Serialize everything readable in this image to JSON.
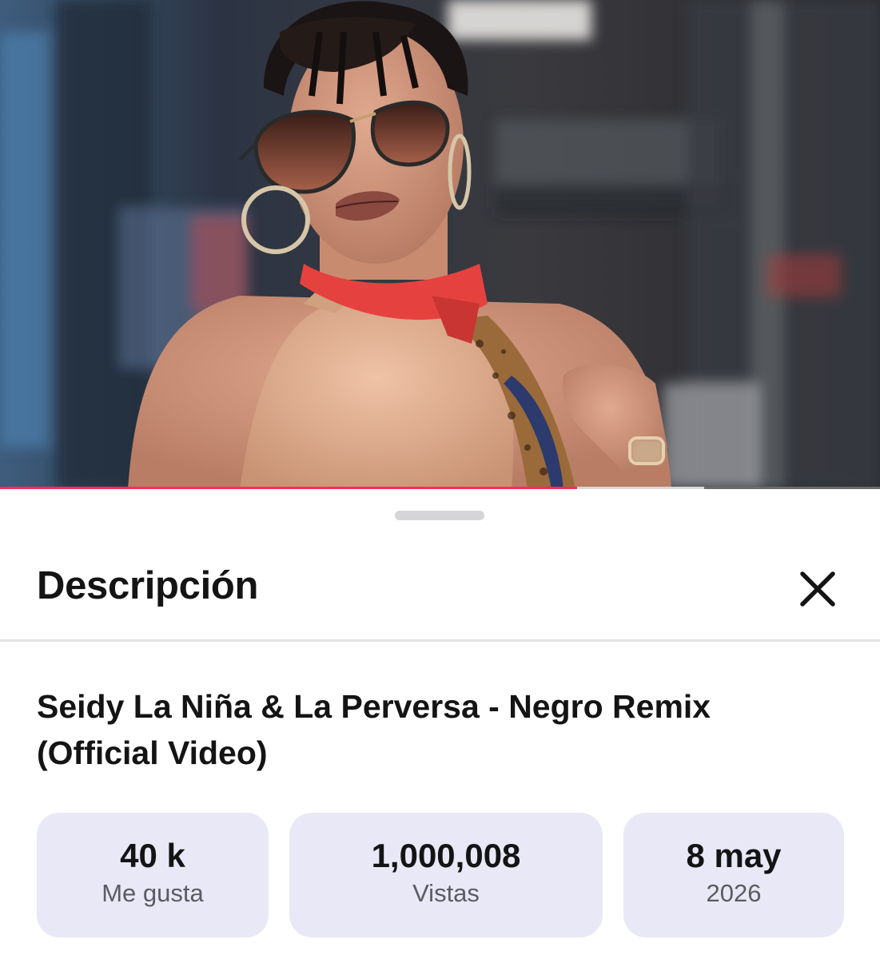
{
  "player": {
    "played_fraction": 0.656,
    "buffered_fraction": 0.8,
    "accent_color": "#ff2d55"
  },
  "sheet": {
    "title": "Descripción",
    "close_icon": "close-icon",
    "video_title": "Seidy La Niña & La Perversa - Negro Remix (Official Video)",
    "stats": [
      {
        "value": "40 k",
        "label": "Me gusta"
      },
      {
        "value": "1,000,008",
        "label": "Vistas"
      },
      {
        "value": "8 may",
        "label": "2026"
      }
    ],
    "card_color": "#e9e8f7"
  }
}
